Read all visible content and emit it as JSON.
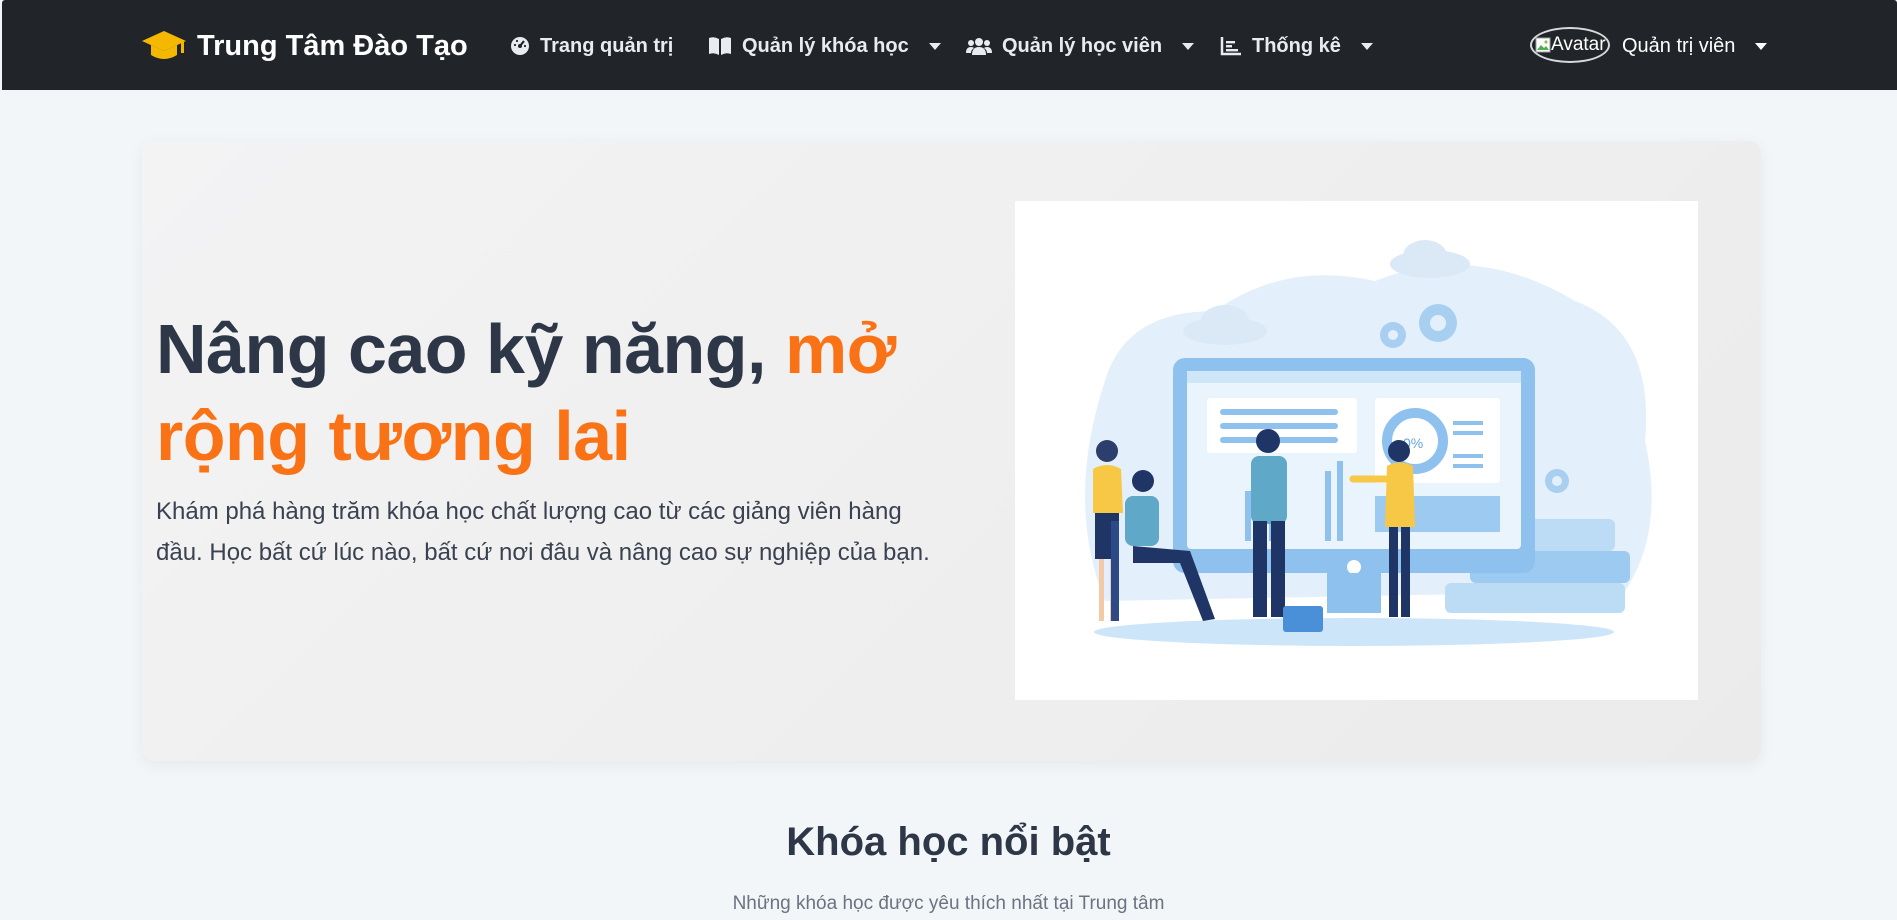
{
  "navbar": {
    "brand": "Trung Tâm Đào Tạo",
    "items": [
      {
        "label": "Trang quản trị",
        "icon": "speedometer-icon",
        "dropdown": false
      },
      {
        "label": "Quản lý khóa học",
        "icon": "book-icon",
        "dropdown": true
      },
      {
        "label": "Quản lý học viên",
        "icon": "users-icon",
        "dropdown": true
      },
      {
        "label": "Thống kê",
        "icon": "chart-icon",
        "dropdown": true
      }
    ],
    "avatar_alt": "Avatar",
    "user_label": "Quản trị viên"
  },
  "hero": {
    "title_plain": "Nâng cao kỹ năng,",
    "title_accent": "mở rộng tương lai",
    "description": "Khám phá hàng trăm khóa học chất lượng cao từ các giảng viên hàng đầu. Học bất cứ lúc nào, bất cứ nơi đâu và nâng cao sự nghiệp của bạn.",
    "illustration_text": "0%"
  },
  "featured": {
    "title": "Khóa học nổi bật",
    "subtitle": "Những khóa học được yêu thích nhất tại Trung tâm"
  },
  "colors": {
    "navbar_bg": "#212529",
    "accent": "#f97316",
    "brand_icon": "#f5b800",
    "heading": "#2d3748"
  }
}
